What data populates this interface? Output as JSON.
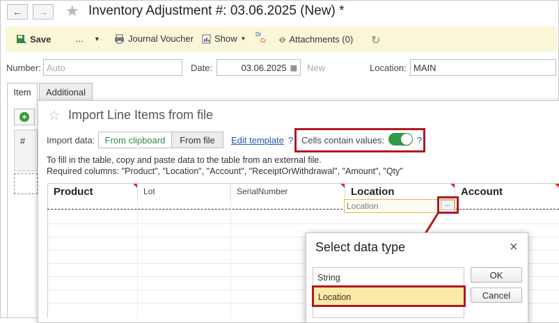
{
  "window": {
    "title": "Inventory Adjustment #:  03.06.2025 (New) *"
  },
  "nav": {
    "back_icon": "←",
    "forward_icon": "→",
    "star_icon": "★"
  },
  "toolbar": {
    "save_label": "Save",
    "more_label": "...",
    "journal_voucher_label": "Journal Voucher",
    "show_label": "Show",
    "dr_label": "Dr",
    "cr_label": "Cr",
    "attachments_label": "Attachments (0)"
  },
  "fields": {
    "number_label": "Number:",
    "number_placeholder": "Auto",
    "date_label": "Date:",
    "date_value": "03.06.2025",
    "new_label": "New",
    "location_label": "Location:",
    "location_value": "MAIN"
  },
  "tabs": [
    {
      "label": "Item"
    },
    {
      "label": "Additional"
    }
  ],
  "background_table": {
    "hash_header": "#"
  },
  "import_dialog": {
    "title": "Import Line Items from file",
    "import_data_label": "Import data:",
    "from_clipboard_label": "From clipboard",
    "from_file_label": "From file",
    "edit_template_label": "Edit template",
    "help_label": "?",
    "cells_contain_values_label": "Cells contain values:",
    "cells_contain_values_on": true,
    "instruction_line1": "To fill in the table, copy and paste data to the table from an external file.",
    "instruction_line2": "Required columns: \"Product\", \"Location\", \"Account\", \"ReceiptOrWithdrawal\", \"Amount\", \"Qty\"",
    "columns": [
      "Product",
      "Lot",
      "SerialNumber",
      "Location",
      "Account"
    ],
    "active_cell_value": "Location",
    "choice_button_label": "..."
  },
  "select_dialog": {
    "title": "Select data type",
    "close_icon": "×",
    "options": [
      "String",
      "Location"
    ],
    "selected": "Location",
    "ok_label": "OK",
    "cancel_label": "Cancel"
  },
  "colors": {
    "accent": "#2e9b4a",
    "highlight_border": "#b01820",
    "toolbar_bg": "#faf6d8",
    "selection_bg": "#fbe9a6",
    "link": "#2456b0"
  }
}
